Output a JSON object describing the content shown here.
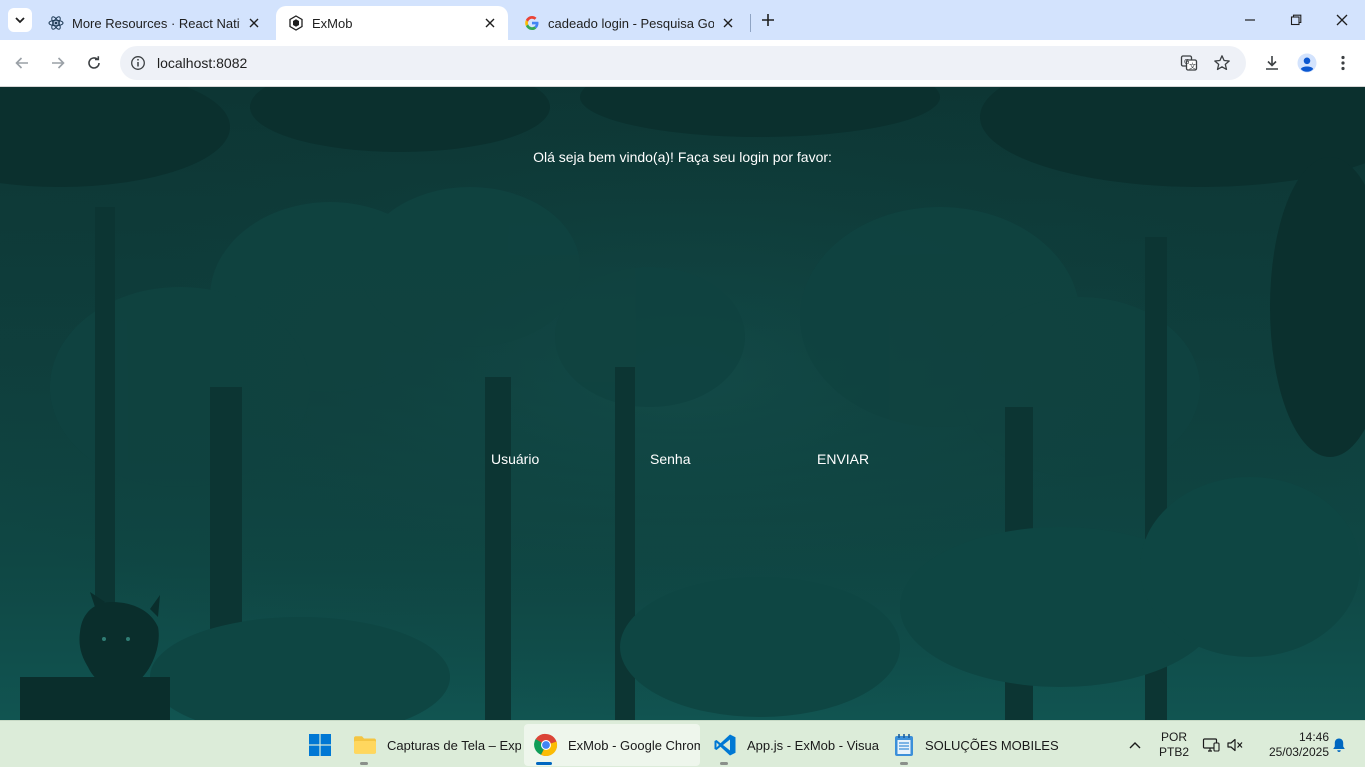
{
  "browser": {
    "tabs": [
      {
        "title": "More Resources · React Native",
        "favicon": "react-icon",
        "active": false
      },
      {
        "title": "ExMob",
        "favicon": "expo-icon",
        "active": true
      },
      {
        "title": "cadeado login - Pesquisa Goog",
        "favicon": "google-icon",
        "active": false
      }
    ],
    "url": "localhost:8082"
  },
  "page": {
    "welcome": "Olá seja bem vindo(a)! Faça seu login por favor:",
    "username_label": "Usuário",
    "password_label": "Senha",
    "submit_label": "ENVIAR"
  },
  "taskbar": {
    "items": [
      {
        "label": "Capturas de Tela – Explo",
        "icon": "folder-icon",
        "active": false
      },
      {
        "label": "ExMob - Google Chrom",
        "icon": "chrome-icon",
        "active": true
      },
      {
        "label": "App.js - ExMob - Visual",
        "icon": "vscode-icon",
        "active": false
      },
      {
        "label": "SOLUÇÕES MOBILES.txt",
        "icon": "notepad-icon",
        "active": false
      }
    ],
    "lang_top": "POR",
    "lang_bottom": "PTB2",
    "time": "14:46",
    "date": "25/03/2025"
  },
  "colors": {
    "tabstrip": "#d3e3fd",
    "page_bg": "#0f3f3d",
    "taskbar": "#dcecd9",
    "accent": "#0067c0"
  }
}
